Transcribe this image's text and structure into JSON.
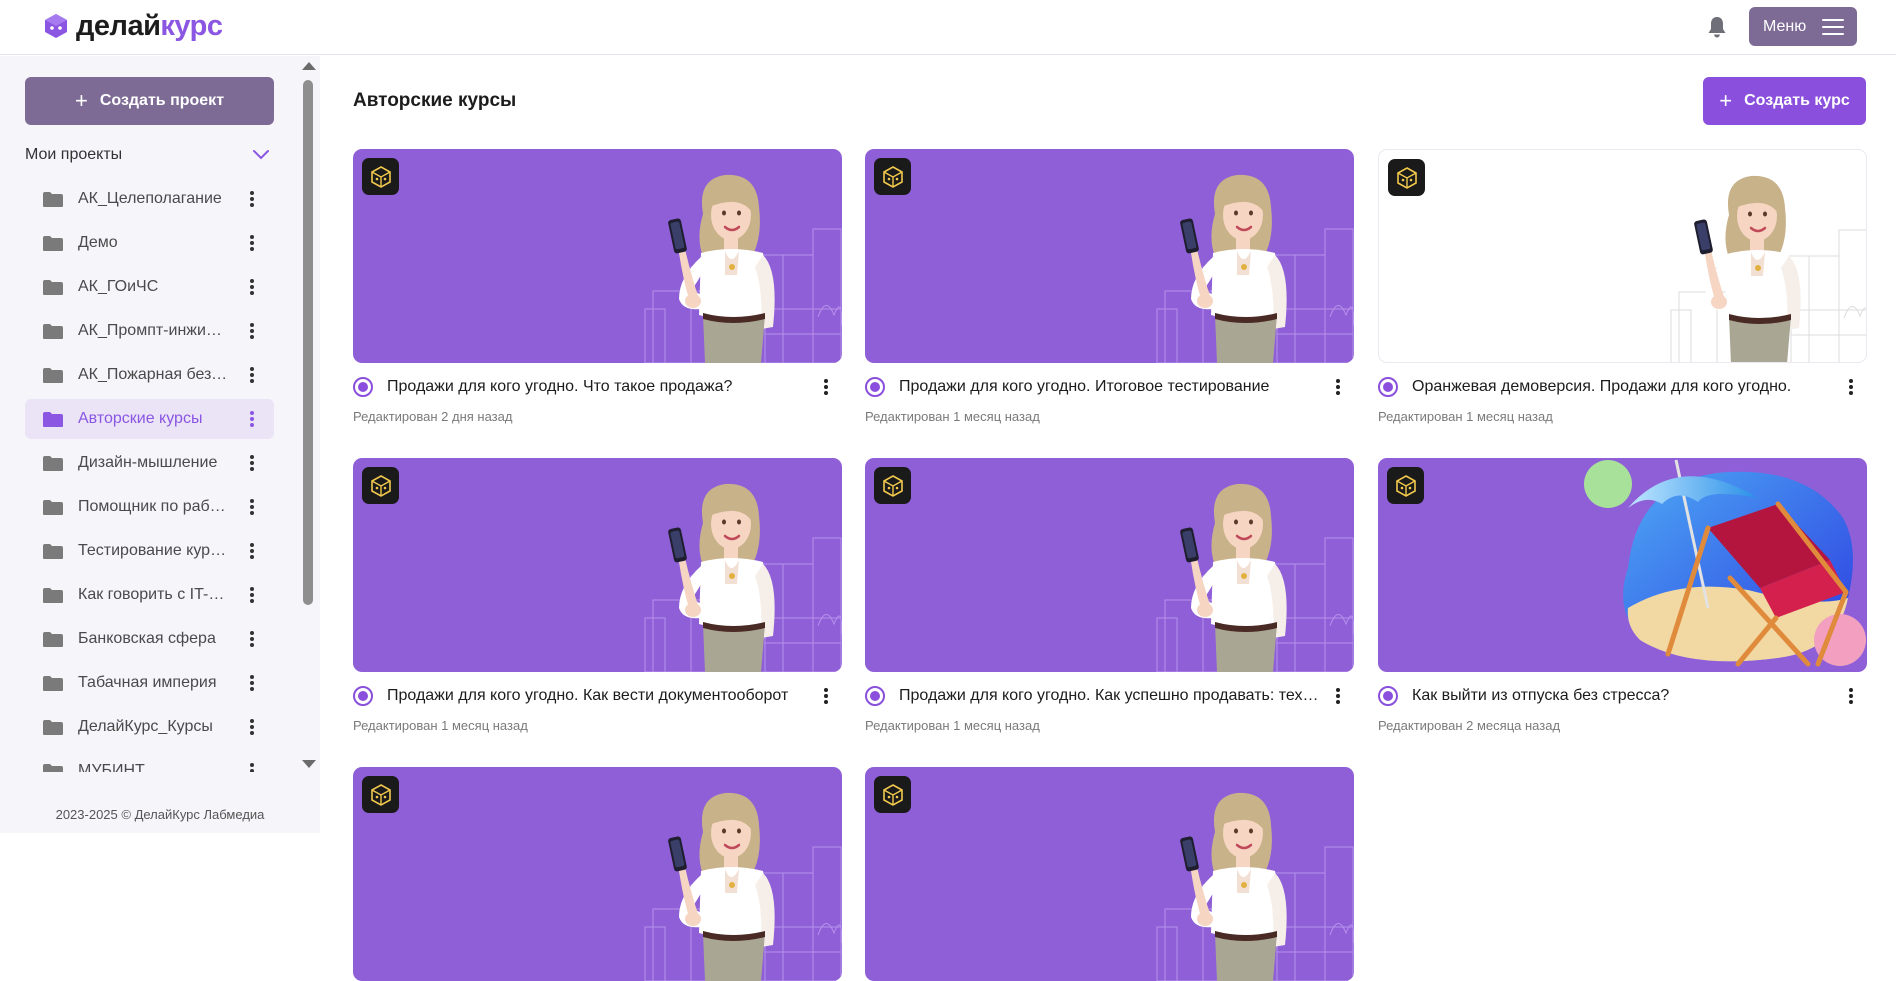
{
  "header": {
    "logo_part1": "делай",
    "logo_part2": "курс",
    "menu_label": "Меню",
    "accent_color": "#8a56e2"
  },
  "sidebar": {
    "create_project_label": "Создать проект",
    "my_projects_label": "Мои проекты",
    "projects": [
      {
        "label": "АК_Целеполагание",
        "active": false
      },
      {
        "label": "Демо",
        "active": false
      },
      {
        "label": "АК_ГОиЧС",
        "active": false
      },
      {
        "label": "АК_Промпт-инжиниринг",
        "active": false
      },
      {
        "label": "АК_Пожарная безопасность",
        "active": false
      },
      {
        "label": "Авторские курсы",
        "active": true
      },
      {
        "label": "Дизайн-мышление",
        "active": false
      },
      {
        "label": "Помощник по работе",
        "active": false
      },
      {
        "label": "Тестирование курсов",
        "active": false
      },
      {
        "label": "Как говорить с IT-специалистами",
        "active": false
      },
      {
        "label": "Банковская сфера",
        "active": false
      },
      {
        "label": "Табачная империя",
        "active": false
      },
      {
        "label": "ДелайКурс_Курсы",
        "active": false
      },
      {
        "label": "МУБИНТ",
        "active": false
      }
    ],
    "footer": "2023-2025 © ДелайКурс Лабмедиа"
  },
  "main": {
    "title": "Авторские курсы",
    "create_course_label": "Создать курс",
    "courses": [
      {
        "title": "Продажи для кого угодно. Что такое продажа?",
        "edited": "Редактирован 2 дня назад",
        "thumb": "woman-purple"
      },
      {
        "title": "Продажи для кого угодно. Итоговое тестирование",
        "edited": "Редактирован 1 месяц назад",
        "thumb": "woman-purple"
      },
      {
        "title": "Оранжевая демоверсия. Продажи для кого угодно.",
        "edited": "Редактирован 1 месяц назад",
        "thumb": "woman-white"
      },
      {
        "title": "Продажи для кого угодно. Как вести документооборот",
        "edited": "Редактирован 1 месяц назад",
        "thumb": "woman-purple"
      },
      {
        "title": "Продажи для кого угодно. Как успешно продавать: техники",
        "edited": "Редактирован 1 месяц назад",
        "thumb": "woman-purple"
      },
      {
        "title": "Как выйти из отпуска без стресса?",
        "edited": "Редактирован 2 месяца назад",
        "thumb": "beach"
      },
      {
        "title": "",
        "edited": "",
        "thumb": "woman-purple"
      },
      {
        "title": "",
        "edited": "",
        "thumb": "woman-purple"
      }
    ]
  }
}
